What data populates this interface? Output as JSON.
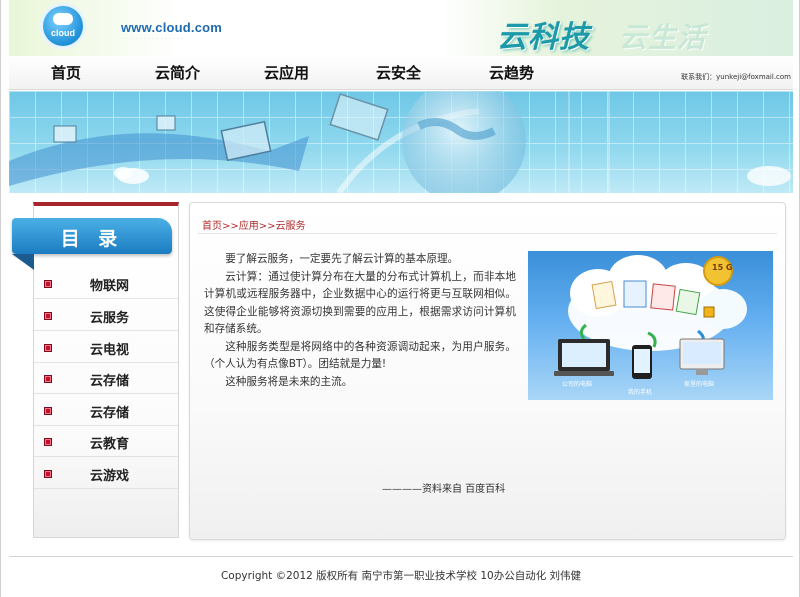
{
  "header": {
    "logo_text": "cloud",
    "site_url": "www.cloud.com",
    "banner_title": "云科技",
    "banner_title2": "云生活"
  },
  "nav": {
    "items": [
      {
        "label": "首页"
      },
      {
        "label": "云简介"
      },
      {
        "label": "云应用"
      },
      {
        "label": "云安全"
      },
      {
        "label": "云趋势"
      }
    ],
    "contact": "联系我们：yunkeji@foxmail.com"
  },
  "sidebar": {
    "title": "目 录",
    "items": [
      {
        "label": "物联网"
      },
      {
        "label": "云服务"
      },
      {
        "label": "云电视"
      },
      {
        "label": "云存储"
      },
      {
        "label": "云存储"
      },
      {
        "label": "云教育"
      },
      {
        "label": "云游戏"
      }
    ]
  },
  "content": {
    "breadcrumb": "首页>>应用>>云服务",
    "paragraphs": [
      "要了解云服务，一定要先了解云计算的基本原理。",
      "云计算：通过使计算分布在大量的分布式计算机上，而非本地计算机或远程服务器中，企业数据中心的运行将更与互联网相似。这使得企业能够将资源切换到需要的应用上，根据需求访问计算机和存储系统。",
      "这种服务类型是将网络中的各种资源调动起来，为用户服务。（个人认为有点像BT）。团结就是力量!",
      "这种服务将是未来的主流。"
    ],
    "source": "————资料来自 百度百科",
    "illustration": {
      "storage_badge": "15 G",
      "captions": [
        "公司的电脑",
        "我的手机",
        "家里的电脑"
      ]
    }
  },
  "footer": {
    "text": "Copyright ©2012 版权所有 南宁市第一职业技术学校 10办公自动化 刘伟健"
  },
  "colors": {
    "accent_red": "#a8252d",
    "menu_blue": "#1c7cc1",
    "breadcrumb_red": "#b02a2a",
    "hero_sky": "#8fd8ee"
  }
}
